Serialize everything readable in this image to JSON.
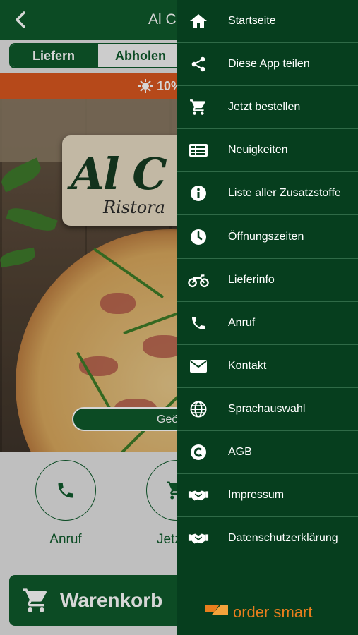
{
  "header": {
    "title": "Al Ca"
  },
  "order_mode": {
    "options": [
      "Liefern",
      "Abholen"
    ],
    "selected": "Liefern"
  },
  "promo": {
    "text": "10%"
  },
  "hero": {
    "logo_main": "Al C",
    "logo_sub": "Ristora",
    "button_label": "Geö"
  },
  "quick_actions": [
    {
      "label": "Anruf",
      "icon": "phone-icon"
    },
    {
      "label": "Jetzt b",
      "icon": "cart-icon"
    }
  ],
  "cart": {
    "label": "Warenkorb"
  },
  "drawer": {
    "items": [
      {
        "label": "Startseite",
        "icon": "home-icon"
      },
      {
        "label": "Diese App teilen",
        "icon": "share-icon"
      },
      {
        "label": "Jetzt bestellen",
        "icon": "cart-icon"
      },
      {
        "label": "Neuigkeiten",
        "icon": "news-icon"
      },
      {
        "label": "Liste aller Zusatzstoffe",
        "icon": "info-icon"
      },
      {
        "label": "Öffnungszeiten",
        "icon": "clock-icon"
      },
      {
        "label": "Lieferinfo",
        "icon": "motorbike-icon"
      },
      {
        "label": "Anruf",
        "icon": "phone-icon"
      },
      {
        "label": "Kontakt",
        "icon": "envelope-icon"
      },
      {
        "label": "Sprachauswahl",
        "icon": "globe-icon"
      },
      {
        "label": "AGB",
        "icon": "copyright-icon"
      },
      {
        "label": "Impressum",
        "icon": "handshake-icon"
      },
      {
        "label": "Datenschutzerklärung",
        "icon": "handshake-icon"
      }
    ],
    "footer_brand": "order smart"
  },
  "colors": {
    "primary": "#0f5a2c",
    "drawer": "#063e1e",
    "promo": "#d9581f",
    "brand": "#e87e1d"
  }
}
